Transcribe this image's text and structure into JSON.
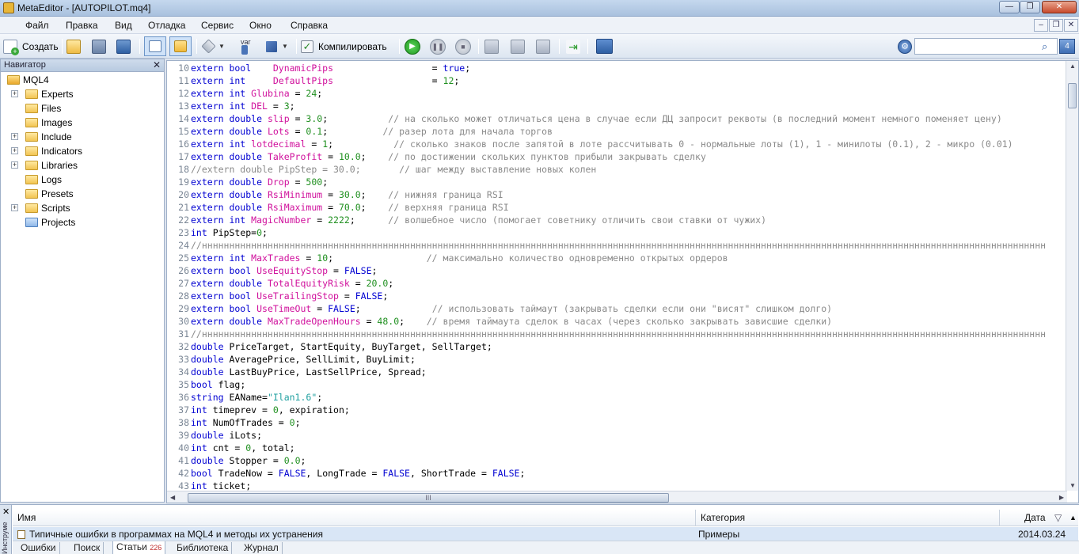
{
  "window": {
    "title": "MetaEditor - [AUTOPILOT.mq4]",
    "minimize": "—",
    "restore": "❐",
    "close": "✕"
  },
  "menu": {
    "items": [
      "Файл",
      "Правка",
      "Вид",
      "Отладка",
      "Сервис",
      "Окно",
      "Справка"
    ],
    "mdi_minimize": "–",
    "mdi_restore": "❐",
    "mdi_close": "✕"
  },
  "toolbar": {
    "create_label": "Создать",
    "var_label": "var",
    "compile_label": "Компилировать",
    "search_value": "",
    "search_counter": "4"
  },
  "navigator": {
    "title": "Навигатор",
    "close": "✕",
    "root": "MQL4",
    "items": [
      {
        "label": "Experts",
        "expandable": true,
        "icon": "folder-icon"
      },
      {
        "label": "Files",
        "expandable": false,
        "icon": "folder-icon"
      },
      {
        "label": "Images",
        "expandable": false,
        "icon": "folder-icon"
      },
      {
        "label": "Include",
        "expandable": true,
        "icon": "folder-icon"
      },
      {
        "label": "Indicators",
        "expandable": true,
        "icon": "folder-icon"
      },
      {
        "label": "Libraries",
        "expandable": true,
        "icon": "folder-icon"
      },
      {
        "label": "Logs",
        "expandable": false,
        "icon": "folder-icon"
      },
      {
        "label": "Presets",
        "expandable": false,
        "icon": "folder-icon"
      },
      {
        "label": "Scripts",
        "expandable": true,
        "icon": "folder-icon"
      },
      {
        "label": "Projects",
        "expandable": false,
        "icon": "project-folder-icon"
      }
    ]
  },
  "editor": {
    "colors": {
      "keyword": "#0000d2",
      "variable": "#d0109c",
      "number": "#209020",
      "string": "#20a0a0",
      "comment": "#8a8a8a"
    },
    "lines": [
      {
        "n": "10",
        "t": [
          [
            "kw",
            "extern bool    "
          ],
          [
            "var",
            "DynamicPips"
          ],
          [
            "txt",
            "                  = "
          ],
          [
            "kw",
            "true"
          ],
          [
            "txt",
            ";"
          ]
        ]
      },
      {
        "n": "11",
        "t": [
          [
            "kw",
            "extern int     "
          ],
          [
            "var",
            "DefaultPips"
          ],
          [
            "txt",
            "                  = "
          ],
          [
            "num",
            "12"
          ],
          [
            "txt",
            ";"
          ]
        ]
      },
      {
        "n": "12",
        "t": [
          [
            "kw",
            "extern int "
          ],
          [
            "var",
            "Glubina"
          ],
          [
            "txt",
            " = "
          ],
          [
            "num",
            "24"
          ],
          [
            "txt",
            ";"
          ]
        ]
      },
      {
        "n": "13",
        "t": [
          [
            "kw",
            "extern int "
          ],
          [
            "var",
            "DEL"
          ],
          [
            "txt",
            " = "
          ],
          [
            "num",
            "3"
          ],
          [
            "txt",
            ";"
          ]
        ]
      },
      {
        "n": "14",
        "t": [
          [
            "kw",
            "extern double "
          ],
          [
            "var",
            "slip"
          ],
          [
            "txt",
            " = "
          ],
          [
            "num",
            "3.0"
          ],
          [
            "txt",
            ";           "
          ],
          [
            "cmt",
            "// на сколько может отличаться цена в случае если ДЦ запросит реквоты (в последний момент немного поменяет цену)"
          ]
        ]
      },
      {
        "n": "15",
        "t": [
          [
            "kw",
            "extern double "
          ],
          [
            "var",
            "Lots"
          ],
          [
            "txt",
            " = "
          ],
          [
            "num",
            "0.1"
          ],
          [
            "txt",
            ";          "
          ],
          [
            "cmt",
            "// разер лота для начала торгов"
          ]
        ]
      },
      {
        "n": "16",
        "t": [
          [
            "kw",
            "extern int "
          ],
          [
            "var",
            "lotdecimal"
          ],
          [
            "txt",
            " = "
          ],
          [
            "num",
            "1"
          ],
          [
            "txt",
            ";           "
          ],
          [
            "cmt",
            "// сколько знаков после запятой в лоте рассчитывать 0 - нормальные лоты (1), 1 - минилоты (0.1), 2 - микро (0.01)"
          ]
        ]
      },
      {
        "n": "17",
        "t": [
          [
            "kw",
            "extern double "
          ],
          [
            "var",
            "TakeProfit"
          ],
          [
            "txt",
            " = "
          ],
          [
            "num",
            "10.0"
          ],
          [
            "txt",
            ";    "
          ],
          [
            "cmt",
            "// по достижении скольких пунктов прибыли закрывать сделку"
          ]
        ]
      },
      {
        "n": "18",
        "t": [
          [
            "cmt",
            "//extern double PipStep = 30.0;       // шаг между выставление новых колен"
          ]
        ]
      },
      {
        "n": "19",
        "t": [
          [
            "kw",
            "extern double "
          ],
          [
            "var",
            "Drop"
          ],
          [
            "txt",
            " = "
          ],
          [
            "num",
            "500"
          ],
          [
            "txt",
            ";"
          ]
        ]
      },
      {
        "n": "20",
        "t": [
          [
            "kw",
            "extern double "
          ],
          [
            "var",
            "RsiMinimum"
          ],
          [
            "txt",
            " = "
          ],
          [
            "num",
            "30.0"
          ],
          [
            "txt",
            ";    "
          ],
          [
            "cmt",
            "// нижняя граница RSI"
          ]
        ]
      },
      {
        "n": "21",
        "t": [
          [
            "kw",
            "extern double "
          ],
          [
            "var",
            "RsiMaximum"
          ],
          [
            "txt",
            " = "
          ],
          [
            "num",
            "70.0"
          ],
          [
            "txt",
            ";    "
          ],
          [
            "cmt",
            "// верхняя граница RSI"
          ]
        ]
      },
      {
        "n": "22",
        "t": [
          [
            "kw",
            "extern int "
          ],
          [
            "var",
            "MagicNumber"
          ],
          [
            "txt",
            " = "
          ],
          [
            "num",
            "2222"
          ],
          [
            "txt",
            ";      "
          ],
          [
            "cmt",
            "// волшебное число (помогает советнику отличить свои ставки от чужих)"
          ]
        ]
      },
      {
        "n": "23",
        "t": [
          [
            "kw",
            "int "
          ],
          [
            "txt",
            "PipStep="
          ],
          [
            "num",
            "0"
          ],
          [
            "txt",
            ";"
          ]
        ]
      },
      {
        "n": "24",
        "t": [
          [
            "cmt",
            "//нннннннннннннннннннннннннннннннннннннннннннннннннннннннннннннннннннннннннннннннннннннннннннннннннннннннннннннннннннннннннннннннннннннннннннннннннннннннннн"
          ]
        ]
      },
      {
        "n": "25",
        "t": [
          [
            "kw",
            "extern int "
          ],
          [
            "var",
            "MaxTrades"
          ],
          [
            "txt",
            " = "
          ],
          [
            "num",
            "10"
          ],
          [
            "txt",
            ";                 "
          ],
          [
            "cmt",
            "// максимально количество одновременно открытых ордеров"
          ]
        ]
      },
      {
        "n": "26",
        "t": [
          [
            "kw",
            "extern bool "
          ],
          [
            "var",
            "UseEquityStop"
          ],
          [
            "txt",
            " = "
          ],
          [
            "kw",
            "FALSE"
          ],
          [
            "txt",
            ";"
          ]
        ]
      },
      {
        "n": "27",
        "t": [
          [
            "kw",
            "extern double "
          ],
          [
            "var",
            "TotalEquityRisk"
          ],
          [
            "txt",
            " = "
          ],
          [
            "num",
            "20.0"
          ],
          [
            "txt",
            ";"
          ]
        ]
      },
      {
        "n": "28",
        "t": [
          [
            "kw",
            "extern bool "
          ],
          [
            "var",
            "UseTrailingStop"
          ],
          [
            "txt",
            " = "
          ],
          [
            "kw",
            "FALSE"
          ],
          [
            "txt",
            ";"
          ]
        ]
      },
      {
        "n": "29",
        "t": [
          [
            "kw",
            "extern bool "
          ],
          [
            "var",
            "UseTimeOut"
          ],
          [
            "txt",
            " = "
          ],
          [
            "kw",
            "FALSE"
          ],
          [
            "txt",
            ";             "
          ],
          [
            "cmt",
            "// использовать таймаут (закрывать сделки если они \"висят\" слишком долго)"
          ]
        ]
      },
      {
        "n": "30",
        "t": [
          [
            "kw",
            "extern double "
          ],
          [
            "var",
            "MaxTradeOpenHours"
          ],
          [
            "txt",
            " = "
          ],
          [
            "num",
            "48.0"
          ],
          [
            "txt",
            ";    "
          ],
          [
            "cmt",
            "// время таймаута сделок в часах (через сколько закрывать зависшие сделки)"
          ]
        ]
      },
      {
        "n": "31",
        "t": [
          [
            "cmt",
            "//нннннннннннннннннннннннннннннннннннннннннннннннннннннннннннннннннннннннннннннннннннннннннннннннннннннннннннннннннннннннннннннннннннннннннннннннннннннннннн"
          ]
        ]
      },
      {
        "n": "32",
        "t": [
          [
            "kw",
            "double "
          ],
          [
            "txt",
            "PriceTarget, StartEquity, BuyTarget, SellTarget;"
          ]
        ]
      },
      {
        "n": "33",
        "t": [
          [
            "kw",
            "double "
          ],
          [
            "txt",
            "AveragePrice, SellLimit, BuyLimit;"
          ]
        ]
      },
      {
        "n": "34",
        "t": [
          [
            "kw",
            "double "
          ],
          [
            "txt",
            "LastBuyPrice, LastSellPrice, Spread;"
          ]
        ]
      },
      {
        "n": "35",
        "t": [
          [
            "kw",
            "bool "
          ],
          [
            "txt",
            "flag;"
          ]
        ]
      },
      {
        "n": "36",
        "t": [
          [
            "kw",
            "string "
          ],
          [
            "txt",
            "EAName="
          ],
          [
            "str",
            "\"Ilan1.6\""
          ],
          [
            "txt",
            ";"
          ]
        ]
      },
      {
        "n": "37",
        "t": [
          [
            "kw",
            "int "
          ],
          [
            "txt",
            "timeprev = "
          ],
          [
            "num",
            "0"
          ],
          [
            "txt",
            ", expiration;"
          ]
        ]
      },
      {
        "n": "38",
        "t": [
          [
            "kw",
            "int "
          ],
          [
            "txt",
            "NumOfTrades = "
          ],
          [
            "num",
            "0"
          ],
          [
            "txt",
            ";"
          ]
        ]
      },
      {
        "n": "39",
        "t": [
          [
            "kw",
            "double "
          ],
          [
            "txt",
            "iLots;"
          ]
        ]
      },
      {
        "n": "40",
        "t": [
          [
            "kw",
            "int "
          ],
          [
            "txt",
            "cnt = "
          ],
          [
            "num",
            "0"
          ],
          [
            "txt",
            ", total;"
          ]
        ]
      },
      {
        "n": "41",
        "t": [
          [
            "kw",
            "double "
          ],
          [
            "txt",
            "Stopper = "
          ],
          [
            "num",
            "0.0"
          ],
          [
            "txt",
            ";"
          ]
        ]
      },
      {
        "n": "42",
        "t": [
          [
            "kw",
            "bool "
          ],
          [
            "txt",
            "TradeNow = "
          ],
          [
            "kw",
            "FALSE"
          ],
          [
            "txt",
            ", LongTrade = "
          ],
          [
            "kw",
            "FALSE"
          ],
          [
            "txt",
            ", ShortTrade = "
          ],
          [
            "kw",
            "FALSE"
          ],
          [
            "txt",
            ";"
          ]
        ]
      },
      {
        "n": "43",
        "t": [
          [
            "kw",
            "int "
          ],
          [
            "txt",
            "ticket;"
          ]
        ]
      }
    ],
    "hscroll_grip": "III"
  },
  "toolbox": {
    "close": "✕",
    "side_title": "Инструме",
    "columns": {
      "name": "Имя",
      "category": "Категория",
      "date": "Дата"
    },
    "sort_icon": "▽",
    "articles": [
      {
        "name": "Типичные ошибки в программах на MQL4 и методы их устранения",
        "category": "Примеры",
        "date": "2014.03.24"
      }
    ],
    "tabs": [
      {
        "label": "Ошибки",
        "badge": ""
      },
      {
        "label": "Поиск",
        "badge": ""
      },
      {
        "label": "Статьи",
        "badge": "226"
      },
      {
        "label": "Библиотека",
        "badge": ""
      },
      {
        "label": "Журнал",
        "badge": ""
      }
    ]
  }
}
